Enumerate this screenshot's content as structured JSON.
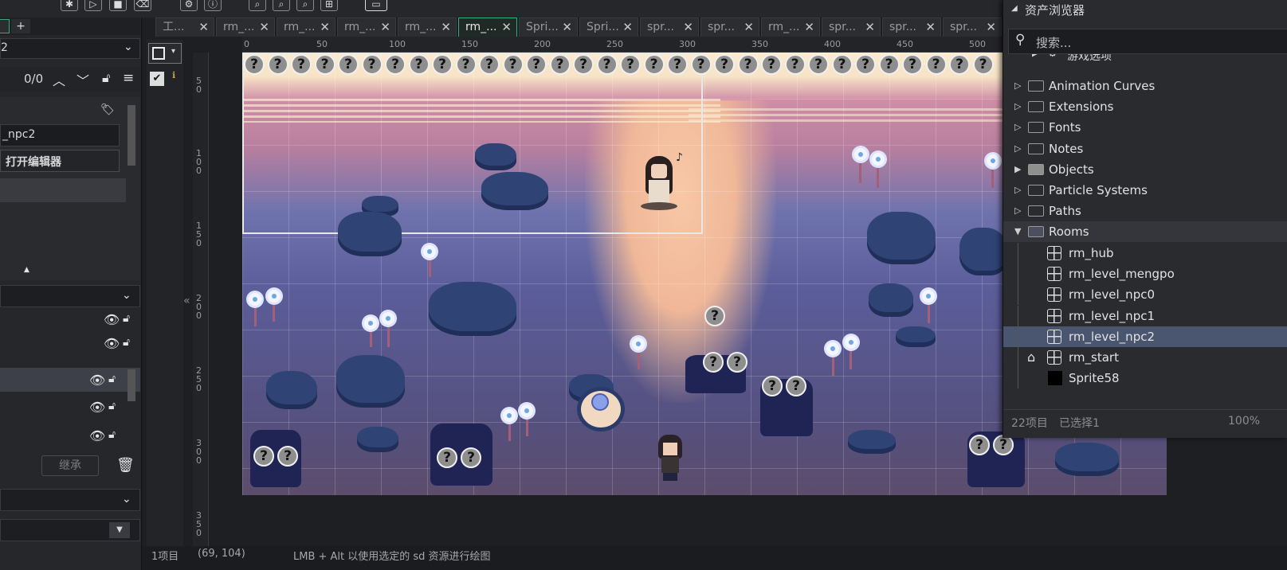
{
  "toolbar": {
    "icons": [
      "debug-icon",
      "export-icon",
      "run-icon",
      "stop-icon",
      "clean-icon",
      "settings-icon",
      "help-icon",
      "zoom-out-icon",
      "zoom-in-icon",
      "zoom-reset-icon",
      "grid-icon",
      "window-icon"
    ]
  },
  "tabs": [
    {
      "label": "工..."
    },
    {
      "label": "rm_..."
    },
    {
      "label": "rm_..."
    },
    {
      "label": "rm_..."
    },
    {
      "label": "rm_..."
    },
    {
      "label": "rm_...",
      "active": true
    },
    {
      "label": "Spri..."
    },
    {
      "label": "Spri..."
    },
    {
      "label": "spr..."
    },
    {
      "label": "spr..."
    },
    {
      "label": "rm_..."
    },
    {
      "label": "spr..."
    },
    {
      "label": "spr..."
    },
    {
      "label": "spr..."
    }
  ],
  "tab_plus": "+",
  "left_panel": {
    "room_dropdown": "2",
    "counter": "0/0",
    "room_name_value": "_npc2",
    "open_editor_label": "打开编辑器",
    "inherit_label": "继承",
    "items_count": "1项目"
  },
  "ruler": {
    "h_ticks": [
      "0",
      "50",
      "100",
      "150",
      "200",
      "250",
      "300",
      "350",
      "400",
      "450",
      "500"
    ],
    "v_ticks": [
      "5\n0",
      "1\n0\n0",
      "1\n5\n0",
      "2\n0\n0",
      "2\n5\n0",
      "3\n0\n0",
      "3\n5\n0"
    ]
  },
  "asset_browser": {
    "title": "资产浏览器",
    "search_placeholder": "搜索...",
    "game_options": "游戏选项",
    "folders": [
      "Animation Curves",
      "Extensions",
      "Fonts",
      "Notes",
      "Objects",
      "Particle Systems",
      "Paths",
      "Rooms"
    ],
    "rooms": [
      "rm_hub",
      "rm_level_mengpo",
      "rm_level_npc0",
      "rm_level_npc1",
      "rm_level_npc2",
      "rm_start",
      "Sprite58"
    ],
    "selected_room": "rm_level_npc2",
    "footer_count": "22项目",
    "footer_selected": "已选择1",
    "footer_zoom": "100%"
  },
  "status_bar": {
    "coords": "(69, 104)",
    "hint": "LMB + Alt 以使用选定的 sd 资源进行绘图"
  },
  "canvas": {
    "question_mark": "?"
  },
  "colors": {
    "accent": "#2fae7a",
    "selected_row": "#4a5570",
    "panel": "#2a2b2f"
  }
}
